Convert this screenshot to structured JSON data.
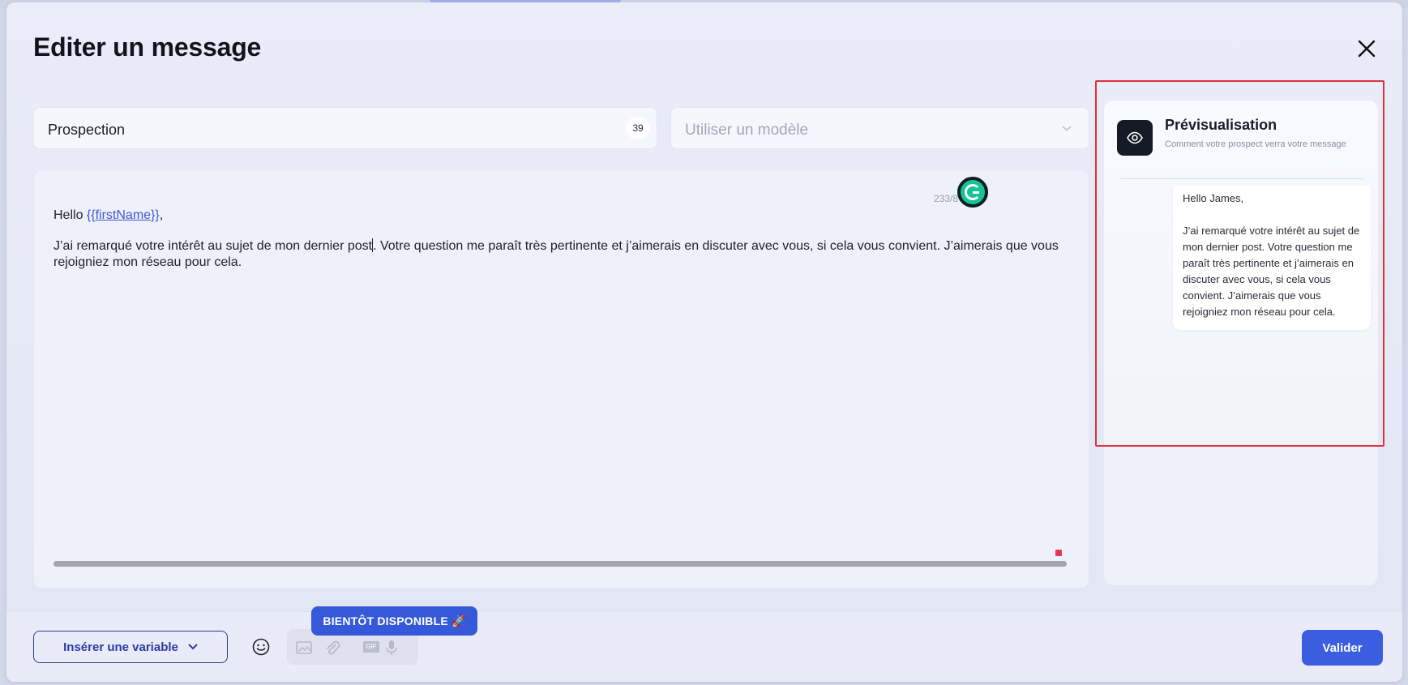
{
  "modal": {
    "title": "Editer un message"
  },
  "form": {
    "name_value": "Prospection",
    "name_char_count": "39",
    "template_placeholder": "Utiliser un modèle"
  },
  "editor": {
    "char_counter": "233/8",
    "greeting_prefix": "Hello ",
    "greeting_var_open": "{{",
    "greeting_var_name": "firstName",
    "greeting_var_close": "}}",
    "greeting_suffix": ",",
    "body_before_caret": "J’ai remarqué votre intérêt au sujet de mon dernier post",
    "body_after_caret": ". Votre question me paraît très pertinente et j’aimerais en discuter avec vous, si cela vous convient. J’aimerais que vous rejoigniez mon réseau pour cela."
  },
  "preview": {
    "title": "Prévisualisation",
    "subtitle": "Comment votre prospect verra votre message",
    "greeting": "Hello James,",
    "body": "J’ai remarqué votre intérêt au sujet de mon dernier post. Votre question me paraît très pertinente et j’aimerais en discuter avec vous, si cela vous convient. J’aimerais que vous rejoigniez mon réseau pour cela."
  },
  "footer": {
    "insert_variable_label": "Insérer une variable",
    "coming_soon_label": "BIENTÔT DISPONIBLE 🚀",
    "gif_label": "GIF",
    "validate_label": "Valider"
  },
  "colors": {
    "accent": "#3b5de0",
    "highlight": "#e0303a",
    "grammarly": "#15c39a"
  },
  "icons": {
    "close": "close-icon",
    "chevron": "chevron-down-icon",
    "eye": "eye-icon",
    "emoji": "smiley-icon",
    "image": "image-icon",
    "attachment": "paperclip-icon",
    "gif": "gif-icon",
    "microphone": "microphone-icon"
  }
}
